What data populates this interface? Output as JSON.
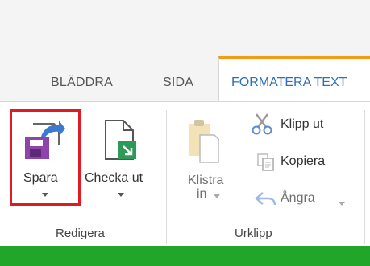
{
  "tabs": [
    {
      "label": "BLÄDDRA"
    },
    {
      "label": "SIDA"
    },
    {
      "label": "FORMATERA TEXT"
    }
  ],
  "groups": {
    "redigera": {
      "label": "Redigera",
      "spara": {
        "label": "Spara"
      },
      "checka_ut": {
        "label": "Checka ut"
      }
    },
    "urklipp": {
      "label": "Urklipp",
      "klistra_line1": "Klistra",
      "klistra_line2": "in",
      "klipp_ut": "Klipp ut",
      "kopiera": "Kopiera",
      "angra": "Ångra"
    }
  },
  "colors": {
    "accent_tab": "#f39c12",
    "active_tab_text": "#2f6fb7",
    "highlight": "#e01b22",
    "brand_bar": "#21a62a",
    "save_icon": "#8e44ad"
  }
}
